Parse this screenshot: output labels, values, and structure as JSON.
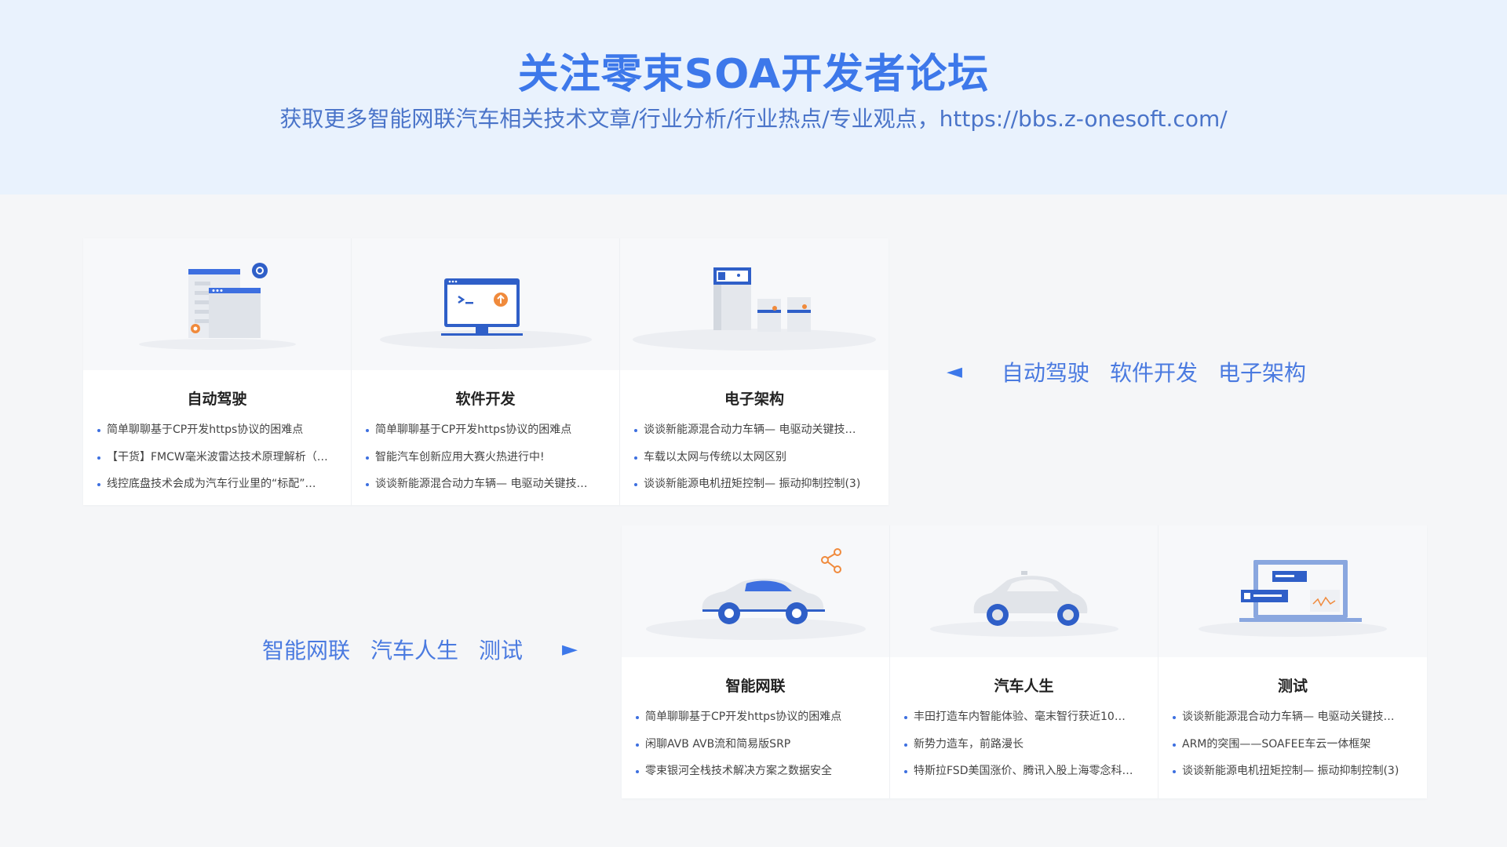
{
  "header": {
    "title": "关注零束SOA开发者论坛",
    "subtitle": "获取更多智能网联汽车相关技术文章/行业分析/行业热点/专业观点，https://bbs.z-onesoft.com/"
  },
  "nav_top": {
    "arrow": "◄",
    "tabs": [
      "自动驾驶",
      "软件开发",
      "电子架构"
    ]
  },
  "nav_bottom": {
    "arrow": "►",
    "tabs": [
      "智能网联",
      "汽车人生",
      "测试"
    ]
  },
  "top_cards": [
    {
      "title": "自动驾驶",
      "icon": "browser-windows-gear-icon",
      "items": [
        "简单聊聊基于CP开发https协议的困难点",
        "【干货】FMCW毫米波雷达技术原理解析（…",
        "线控底盘技术会成为汽车行业里的“标配”…"
      ]
    },
    {
      "title": "软件开发",
      "icon": "monitor-terminal-icon",
      "items": [
        "简单聊聊基于CP开发https协议的困难点",
        "智能汽车创新应用大赛火热进行中!",
        "谈谈新能源混合动力车辆— 电驱动关键技…"
      ]
    },
    {
      "title": "电子架构",
      "icon": "server-devices-icon",
      "items": [
        "谈谈新能源混合动力车辆— 电驱动关键技…",
        "车载以太网与传统以太网区别",
        "谈谈新能源电机扭矩控制— 振动抑制控制(3)"
      ]
    }
  ],
  "bottom_cards": [
    {
      "title": "智能网联",
      "icon": "connected-car-icon",
      "items": [
        "简单聊聊基于CP开发https协议的困难点",
        "闲聊AVB AVB流和简易版SRP",
        "零束银河全栈技术解决方案之数据安全"
      ]
    },
    {
      "title": "汽车人生",
      "icon": "sedan-car-icon",
      "items": [
        "丰田打造车内智能体验、毫末智行获近10…",
        "新势力造车，前路漫长",
        "特斯拉FSD美国涨价、腾讯入股上海零念科…"
      ]
    },
    {
      "title": "测试",
      "icon": "laptop-test-icon",
      "items": [
        "谈谈新能源混合动力车辆— 电驱动关键技…",
        "ARM的突围——SOAFEE车云一体框架",
        "谈谈新能源电机扭矩控制— 振动抑制控制(3)"
      ]
    }
  ],
  "colors": {
    "accent": "#3d78ea",
    "header_bg": "#e9f2fd",
    "page_bg": "#f5f6f8",
    "orange": "#f08a3c"
  }
}
